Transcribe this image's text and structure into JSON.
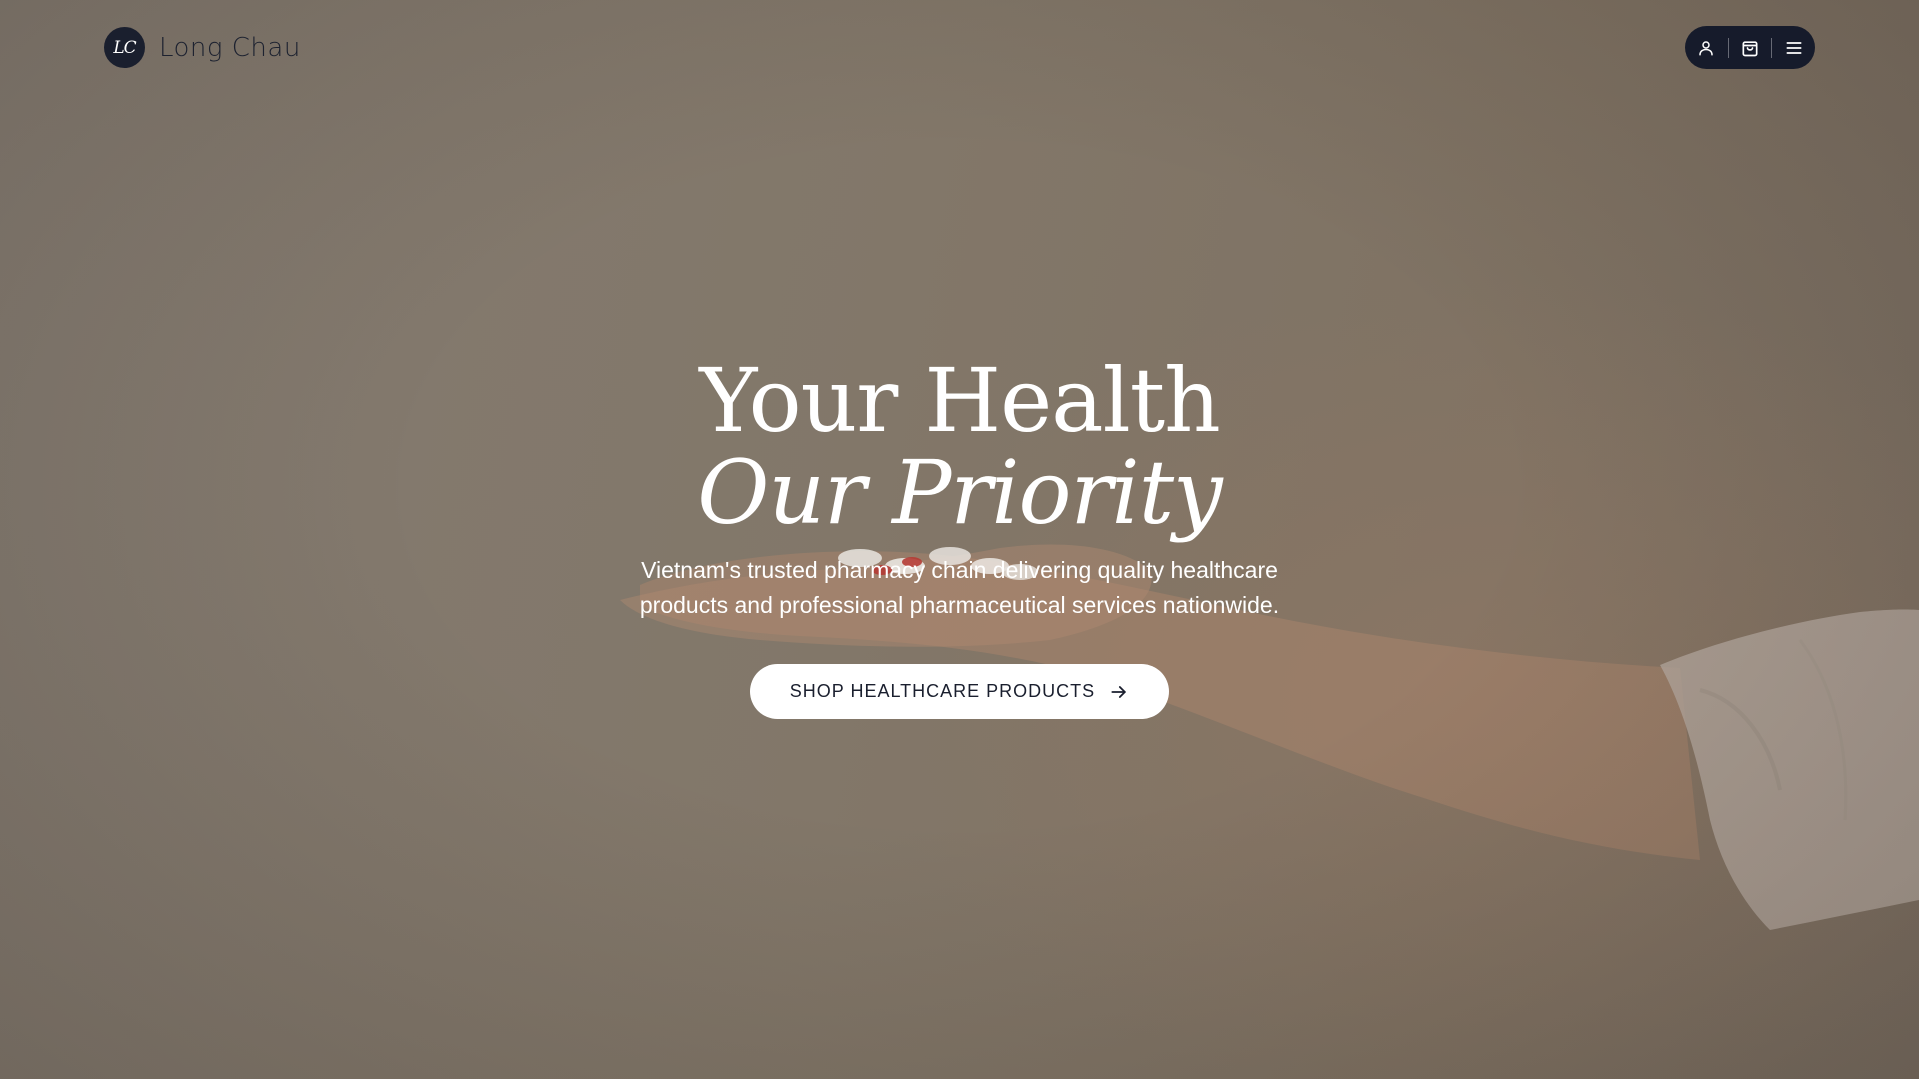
{
  "header": {
    "logo_initials": "LC",
    "brand_name": "Long Chau",
    "icons": [
      "user-icon",
      "shopping-bag-icon",
      "menu-icon"
    ]
  },
  "hero": {
    "title_line1": "Your Health",
    "title_line2": "Our Priority",
    "subtitle": "Vietnam's trusted pharmacy chain delivering quality healthcare products and professional pharmaceutical services nationwide.",
    "cta_label": "SHOP HEALTHCARE PRODUCTS",
    "cta_icon": "arrow-right-icon"
  },
  "colors": {
    "background": "#827769",
    "nav_pill": "#161b2b",
    "logo_badge": "#1a1f2e",
    "text_light": "#ffffff",
    "text_dark": "#1a1f2e"
  }
}
